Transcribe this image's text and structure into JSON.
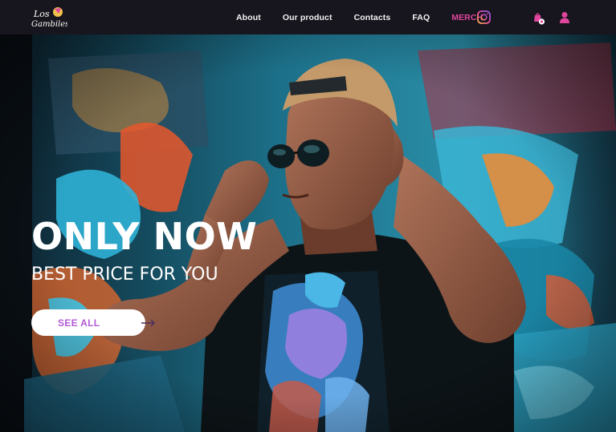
{
  "brand": {
    "logo_text": "Los Gambiles"
  },
  "nav": {
    "links": [
      "About",
      "Our product",
      "Contacts",
      "FAQ"
    ],
    "merch": "MERCH",
    "icons": [
      "instagram-icon",
      "shopping-bag-icon",
      "user-icon"
    ]
  },
  "hero": {
    "headline": "ONLY NOW",
    "subline": "BEST PRICE FOR YOU",
    "cta_label": "SEE ALL"
  },
  "colors": {
    "nav_bg": "#17151d",
    "accent": "#e0469e",
    "cta_text": "#b35bd6",
    "text": "#ffffff"
  }
}
